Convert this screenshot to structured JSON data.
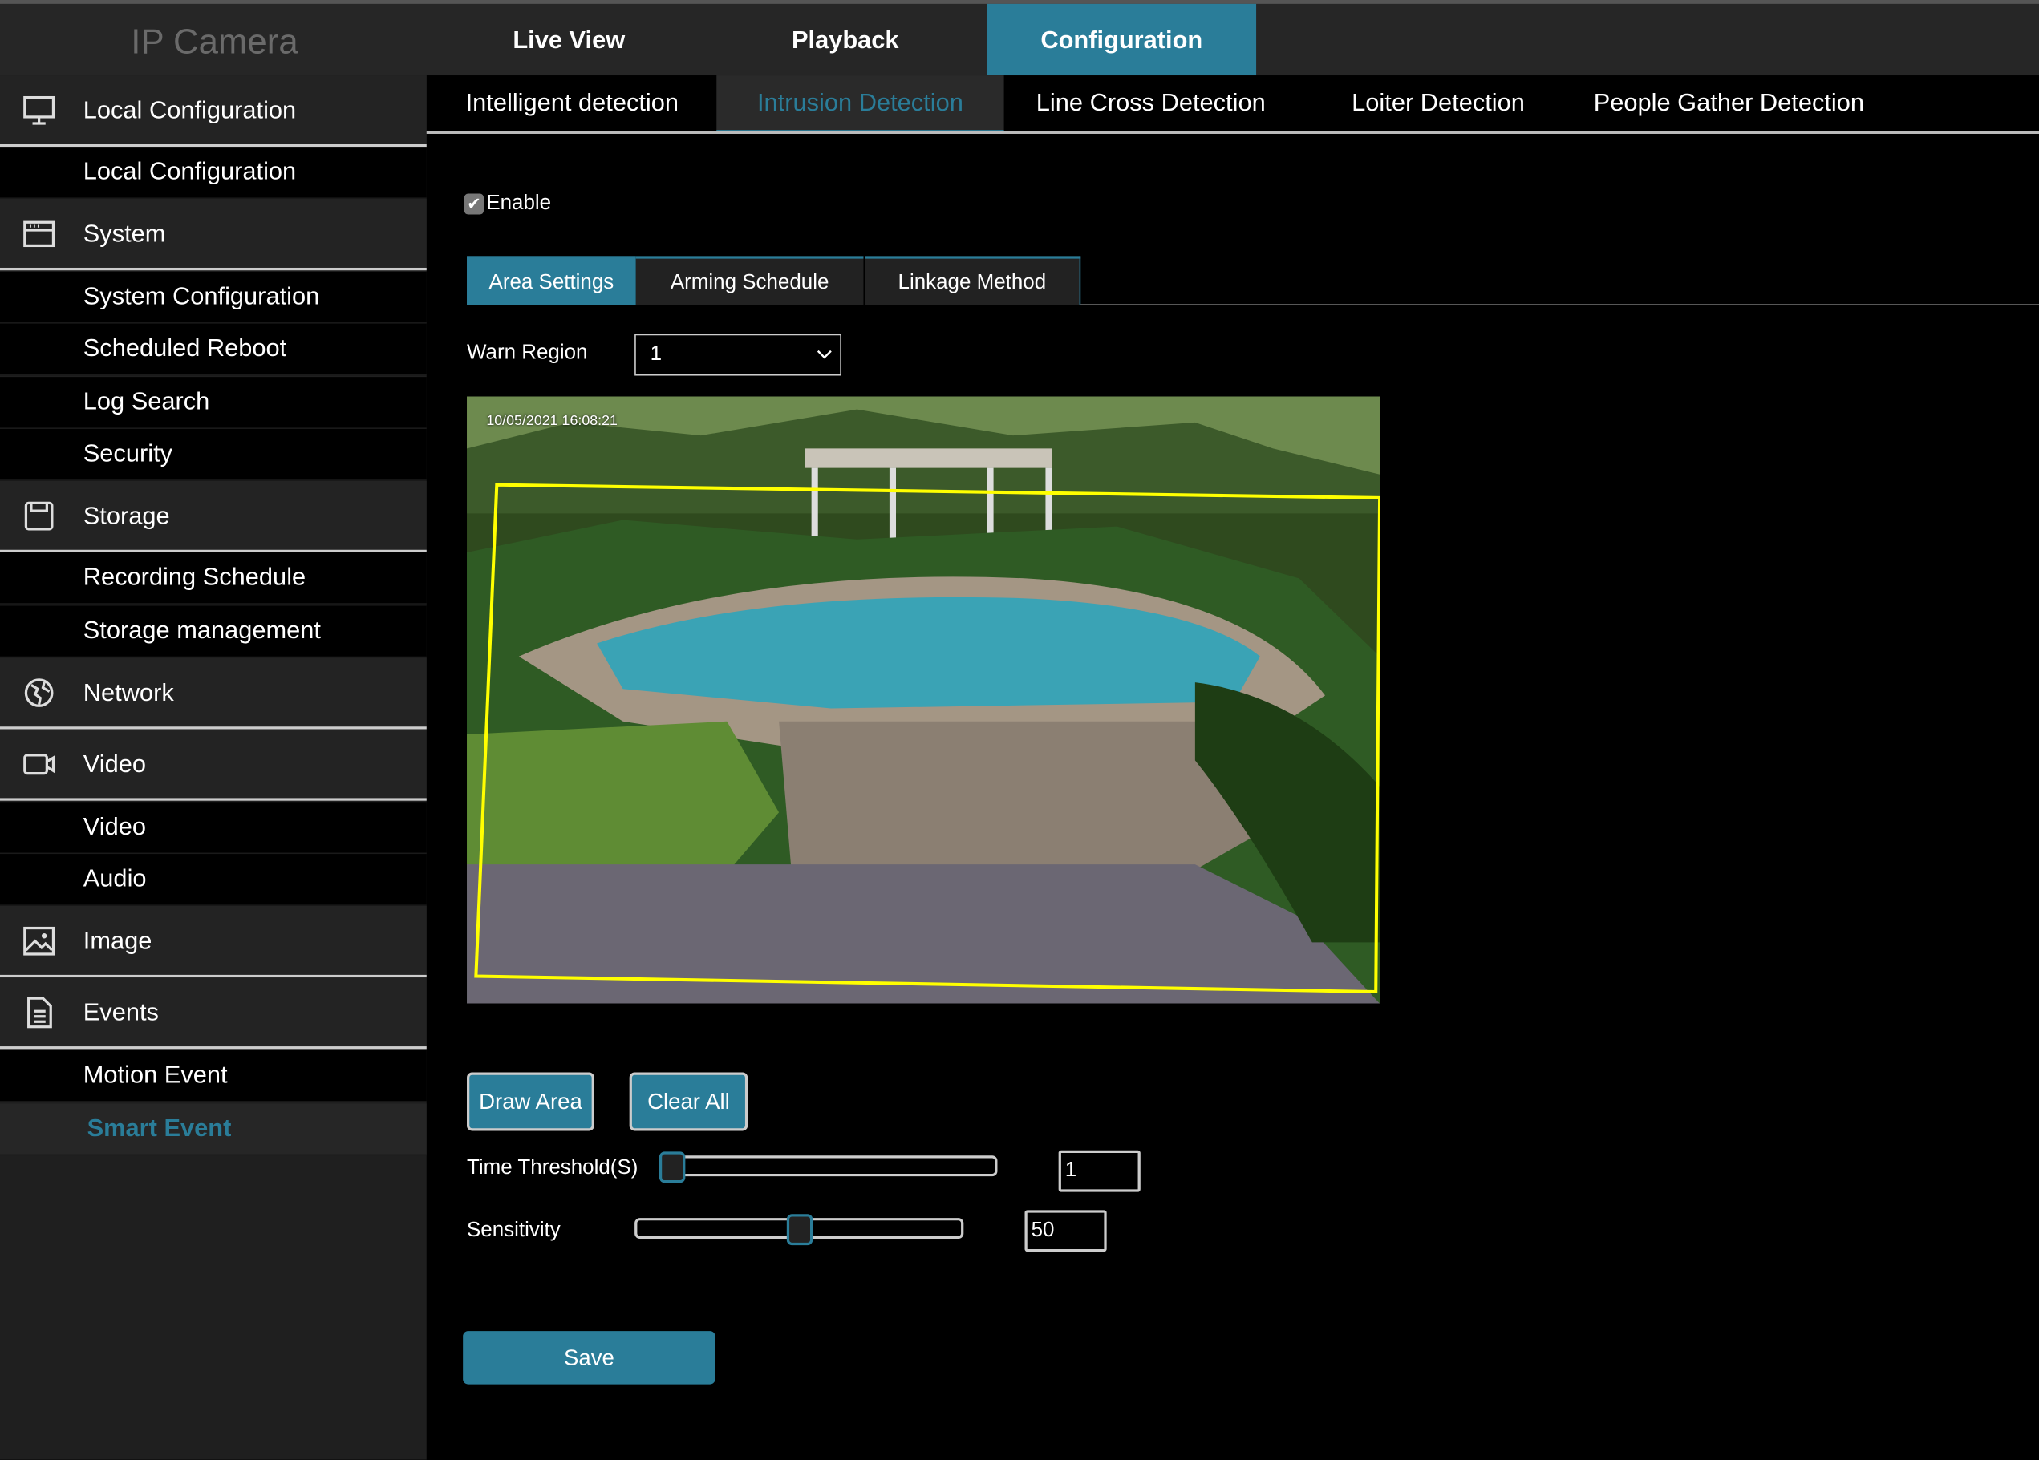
{
  "app": {
    "logo": "IP Camera"
  },
  "topnav": {
    "tabs": [
      {
        "label": "Live View"
      },
      {
        "label": "Playback"
      },
      {
        "label": "Configuration",
        "active": true
      }
    ]
  },
  "sidebar": {
    "groups": [
      {
        "label": "Local Configuration",
        "icon": "monitor-icon",
        "items": [
          "Local Configuration"
        ]
      },
      {
        "label": "System",
        "icon": "system-icon",
        "items": [
          "System Configuration",
          "Scheduled Reboot",
          "Log Search",
          "Security"
        ]
      },
      {
        "label": "Storage",
        "icon": "storage-icon",
        "items": [
          "Recording Schedule",
          "Storage management"
        ]
      },
      {
        "label": "Network",
        "icon": "globe-icon",
        "items": []
      },
      {
        "label": "Video",
        "icon": "video-camera-icon",
        "items": [
          "Video",
          "Audio"
        ]
      },
      {
        "label": "Image",
        "icon": "image-icon",
        "items": []
      },
      {
        "label": "Events",
        "icon": "document-icon",
        "items": [
          "Motion Event",
          "Smart Event"
        ]
      }
    ],
    "active_item": "Smart Event"
  },
  "subtabs": [
    {
      "label": "Intelligent detection"
    },
    {
      "label": "Intrusion Detection",
      "active": true
    },
    {
      "label": "Line Cross Detection"
    },
    {
      "label": "Loiter Detection"
    },
    {
      "label": "People Gather Detection"
    }
  ],
  "enable": {
    "label": "Enable",
    "checked": true
  },
  "area_tabs": [
    {
      "label": "Area Settings",
      "active": true
    },
    {
      "label": "Arming Schedule"
    },
    {
      "label": "Linkage Method"
    }
  ],
  "warn_region": {
    "label": "Warn Region",
    "value": "1"
  },
  "video": {
    "timestamp": "10/05/2021  16:08:21",
    "region_color": "#ffff00"
  },
  "buttons": {
    "draw_area": "Draw Area",
    "clear_all": "Clear All",
    "save": "Save"
  },
  "time_threshold": {
    "label": "Time Threshold(S)",
    "value": "1",
    "slider_fraction": 0.0
  },
  "sensitivity": {
    "label": "Sensitivity",
    "value": "50",
    "slider_fraction": 0.5
  },
  "colors": {
    "accent": "#2a7d99",
    "background": "#000000",
    "panel": "#232323"
  }
}
